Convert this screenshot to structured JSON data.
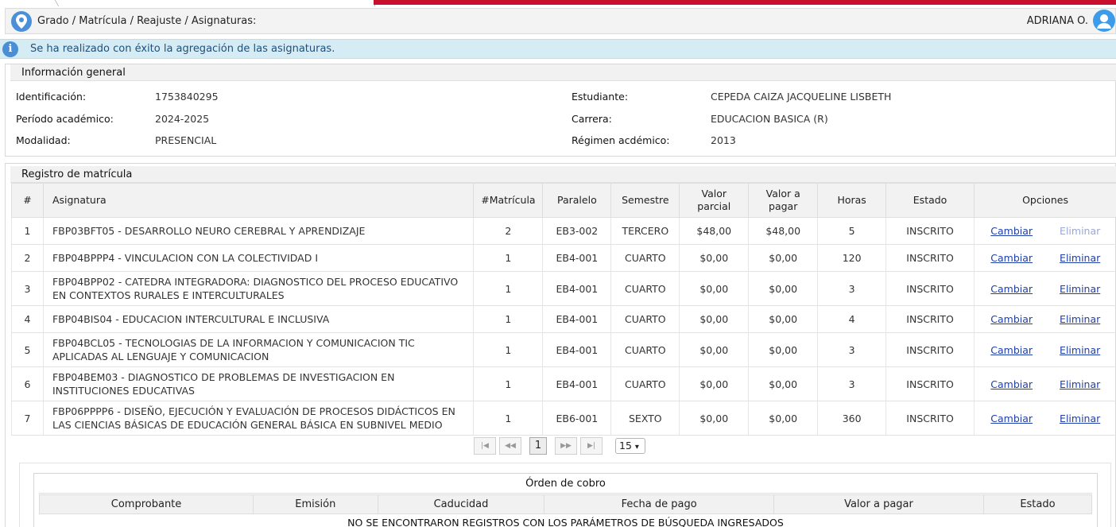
{
  "breadcrumb": "Grado / Matrícula / Reajuste / Asignaturas:",
  "user": {
    "name": "ADRIANA O."
  },
  "alert": {
    "message": "Se ha realizado con éxito la agregación de las asignaturas."
  },
  "general": {
    "title": "Información general",
    "left": [
      {
        "label": "Identificación:",
        "value": "1753840295"
      },
      {
        "label": "Período académico:",
        "value": "2024-2025"
      },
      {
        "label": "Modalidad:",
        "value": "PRESENCIAL"
      }
    ],
    "right": [
      {
        "label": "Estudiante:",
        "value": "CEPEDA CAIZA JACQUELINE LISBETH"
      },
      {
        "label": "Carrera:",
        "value": "EDUCACION BASICA (R)"
      },
      {
        "label": "Régimen acdémico:",
        "value": "2013"
      }
    ]
  },
  "registro": {
    "title": "Registro de matrícula",
    "headers": {
      "num": "#",
      "asignatura": "Asignatura",
      "matricula": "#Matrícula",
      "paralelo": "Paralelo",
      "semestre": "Semestre",
      "valor_parcial_1": "Valor",
      "valor_parcial_2": "parcial",
      "valor_pagar_1": "Valor a",
      "valor_pagar_2": "pagar",
      "horas": "Horas",
      "estado": "Estado",
      "opciones": "Opciones"
    },
    "rows": [
      {
        "num": "1",
        "asignatura": "FBP03BFT05 - DESARROLLO NEURO CEREBRAL Y APRENDIZAJE",
        "matricula": "2",
        "paralelo": "EB3-002",
        "semestre": "TERCERO",
        "parcial": "$48,00",
        "pagar": "$48,00",
        "horas": "5",
        "estado": "INSCRITO",
        "cambiar": "Cambiar",
        "eliminar": "Eliminar",
        "eliminar_disabled": true
      },
      {
        "num": "2",
        "asignatura": "FBP04BPPP4 - VINCULACION CON LA COLECTIVIDAD I",
        "matricula": "1",
        "paralelo": "EB4-001",
        "semestre": "CUARTO",
        "parcial": "$0,00",
        "pagar": "$0,00",
        "horas": "120",
        "estado": "INSCRITO",
        "cambiar": "Cambiar",
        "eliminar": "Eliminar",
        "eliminar_disabled": false
      },
      {
        "num": "3",
        "asignatura": "FBP04BPP02 - CATEDRA INTEGRADORA: DIAGNOSTICO DEL PROCESO EDUCATIVO EN CONTEXTOS RURALES E INTERCULTURALES",
        "matricula": "1",
        "paralelo": "EB4-001",
        "semestre": "CUARTO",
        "parcial": "$0,00",
        "pagar": "$0,00",
        "horas": "3",
        "estado": "INSCRITO",
        "cambiar": "Cambiar",
        "eliminar": "Eliminar",
        "eliminar_disabled": false
      },
      {
        "num": "4",
        "asignatura": "FBP04BIS04 - EDUCACION INTERCULTURAL E INCLUSIVA",
        "matricula": "1",
        "paralelo": "EB4-001",
        "semestre": "CUARTO",
        "parcial": "$0,00",
        "pagar": "$0,00",
        "horas": "4",
        "estado": "INSCRITO",
        "cambiar": "Cambiar",
        "eliminar": "Eliminar",
        "eliminar_disabled": false
      },
      {
        "num": "5",
        "asignatura": "FBP04BCL05 - TECNOLOGIAS DE LA INFORMACION Y COMUNICACION TIC APLICADAS AL LENGUAJE Y COMUNICACION",
        "matricula": "1",
        "paralelo": "EB4-001",
        "semestre": "CUARTO",
        "parcial": "$0,00",
        "pagar": "$0,00",
        "horas": "3",
        "estado": "INSCRITO",
        "cambiar": "Cambiar",
        "eliminar": "Eliminar",
        "eliminar_disabled": false
      },
      {
        "num": "6",
        "asignatura": "FBP04BEM03 - DIAGNOSTICO DE PROBLEMAS DE INVESTIGACION EN INSTITUCIONES EDUCATIVAS",
        "matricula": "1",
        "paralelo": "EB4-001",
        "semestre": "CUARTO",
        "parcial": "$0,00",
        "pagar": "$0,00",
        "horas": "3",
        "estado": "INSCRITO",
        "cambiar": "Cambiar",
        "eliminar": "Eliminar",
        "eliminar_disabled": false
      },
      {
        "num": "7",
        "asignatura": "FBP06PPPP6 - DISEÑO, EJECUCIÓN Y EVALUACIÓN DE PROCESOS DIDÁCTICOS EN LAS CIENCIAS BÁSICAS DE EDUCACIÓN GENERAL BÁSICA EN SUBNIVEL MEDIO",
        "matricula": "1",
        "paralelo": "EB6-001",
        "semestre": "SEXTO",
        "parcial": "$0,00",
        "pagar": "$0,00",
        "horas": "360",
        "estado": "INSCRITO",
        "cambiar": "Cambiar",
        "eliminar": "Eliminar",
        "eliminar_disabled": false
      }
    ]
  },
  "pager": {
    "current": "1",
    "page_size": "15"
  },
  "cobro": {
    "title": "Órden de cobro",
    "headers": [
      "Comprobante",
      "Emisión",
      "Caducidad",
      "Fecha de pago",
      "Valor a pagar",
      "Estado"
    ],
    "empty_message": "NO SE ENCONTRARON REGISTROS CON LOS PARÁMETROS DE BÚSQUEDA INGRESADOS"
  },
  "icons": {
    "location": "location-pin-icon",
    "user": "user-avatar-icon",
    "info": "info-icon"
  },
  "colors": {
    "link": "#1f3faa",
    "alert_bg": "#d6ecf5",
    "brand_red": "#c8102e"
  }
}
